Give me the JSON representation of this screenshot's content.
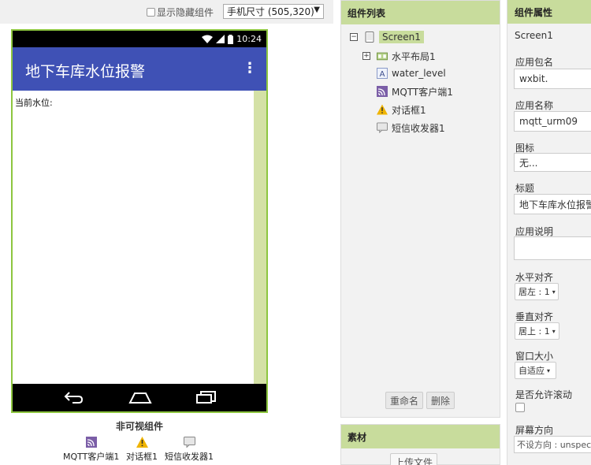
{
  "viewer": {
    "show_hidden_label": "显示隐藏组件",
    "size_select": "手机尺寸 (505,320)",
    "status_time": "10:24",
    "app_title": "地下车库水位报警",
    "water_label": "当前水位:",
    "nonvisible_title": "非可视组件",
    "nonvisible_items": [
      "MQTT客户端1",
      "对话框1",
      "短信收发器1"
    ]
  },
  "components": {
    "title": "组件列表",
    "tree": [
      "Screen1",
      "水平布局1",
      "water_level",
      "MQTT客户端1",
      "对话框1",
      "短信收发器1"
    ],
    "rename_button": "重命名",
    "delete_button": "删除"
  },
  "media": {
    "title": "素材",
    "upload_button": "上传文件"
  },
  "properties": {
    "title": "组件属性",
    "screen_name": "Screen1",
    "app_package_label": "应用包名",
    "app_package_value": "wxbit.",
    "app_name_label": "应用名称",
    "app_name_value": "mqtt_urm09",
    "icon_label": "图标",
    "icon_value": "无...",
    "title_label": "标题",
    "title_value": "地下车库水位报警",
    "about_label": "应用说明",
    "about_value": "",
    "align_h_label": "水平对齐",
    "align_h_value": "居左 : 1",
    "align_v_label": "垂直对齐",
    "align_v_value": "居上 : 1",
    "window_size_label": "窗口大小",
    "window_size_value": "自适应",
    "scrollable_label": "是否允许滚动",
    "orientation_label": "屏幕方向",
    "orientation_value": "不设方向 : unspecified"
  },
  "colors": {
    "app_bar": "#3f51b5",
    "header_green": "#c8dc9c",
    "phone_border": "#8dc63f"
  }
}
